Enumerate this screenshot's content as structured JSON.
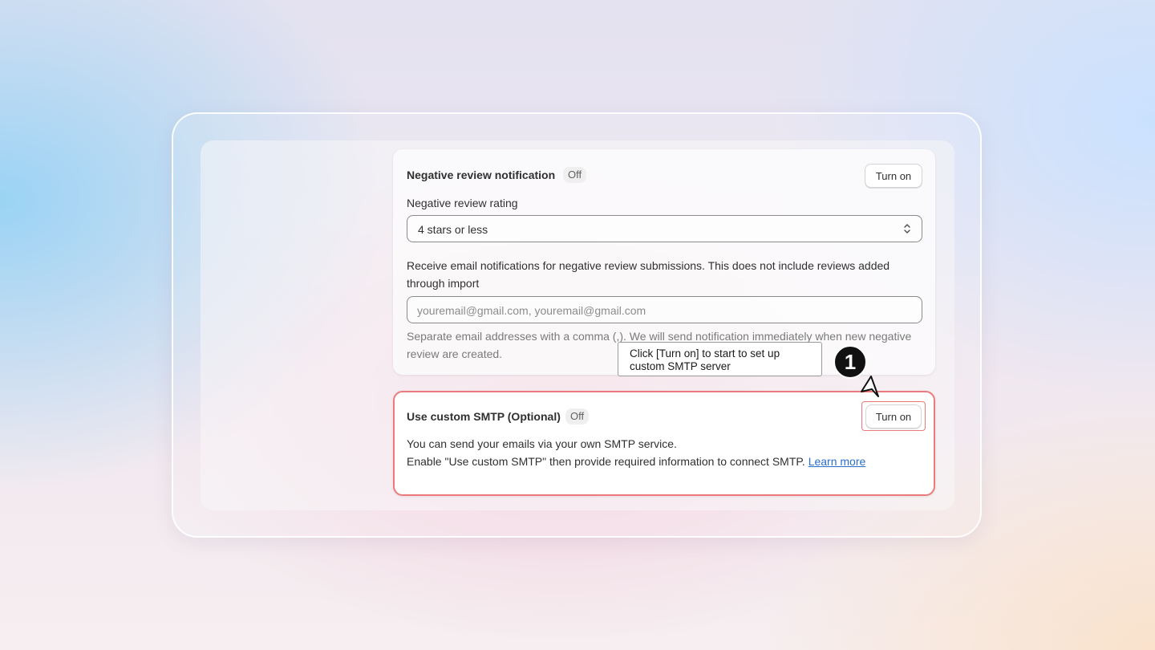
{
  "negative_review": {
    "title": "Negative review notification",
    "status": "Off",
    "button_label": "Turn on",
    "rating_label": "Negative review rating",
    "rating_value": "4 stars or less",
    "description": "Receive email notifications for negative review submissions. This does not include reviews added through import",
    "email_placeholder": "youremail@gmail.com, youremail@gmail.com",
    "help_text": "Separate email addresses with a comma (,). We will send notification immediately when new negative review are created."
  },
  "smtp": {
    "title": "Use custom SMTP (Optional)",
    "status": "Off",
    "button_label": "Turn on",
    "line1": "You can send your emails via your own SMTP service.",
    "line2": "Enable \"Use custom SMTP\" then provide required information to connect SMTP.",
    "link_label": "Learn more"
  },
  "guide": {
    "tooltip_line1": "Click [Turn on] to start to set up",
    "tooltip_line2": "custom SMTP server",
    "step_number": "1"
  },
  "icons": [
    "chevron-up-down-icon",
    "cursor-pointer-icon"
  ],
  "colors": {
    "highlight": "#ec7a7c",
    "link": "#2c6ecb"
  }
}
